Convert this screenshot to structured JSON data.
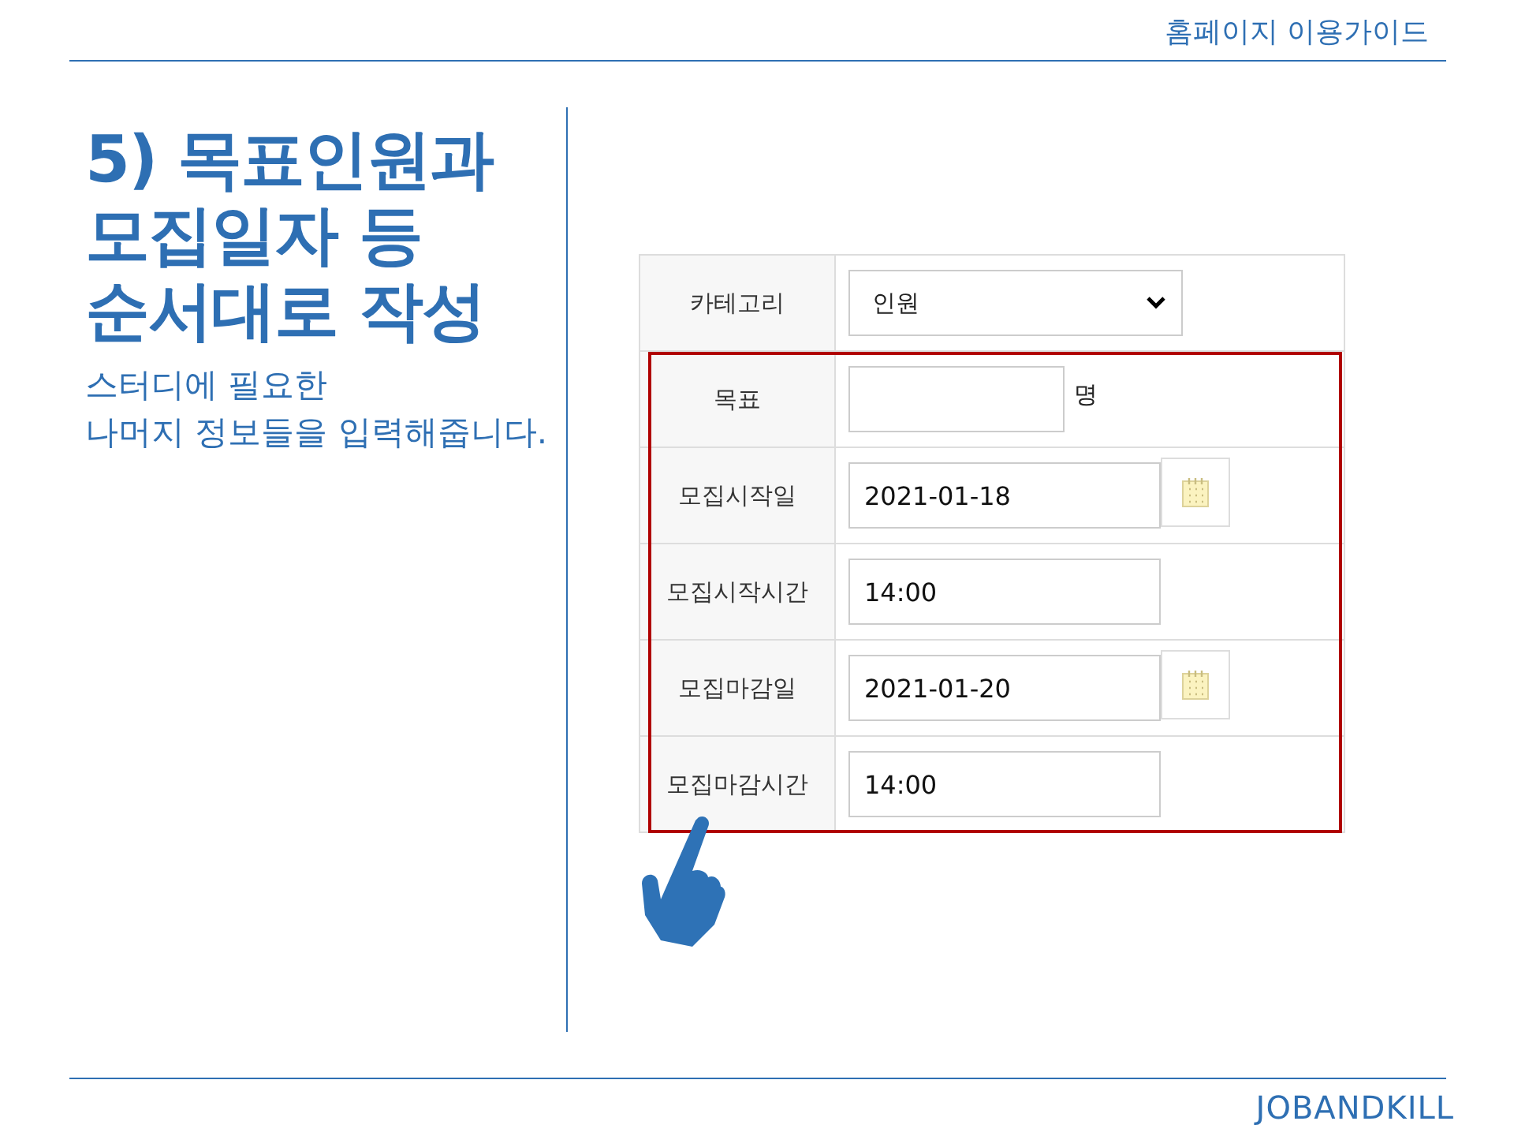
{
  "header": {
    "title": "홈페이지 이용가이드"
  },
  "heading": {
    "lines": [
      "5) 목표인원과",
      "모집일자 등",
      "순서대로 작성"
    ]
  },
  "description": {
    "lines": [
      "스터디에 필요한",
      "나머지 정보들을 입력해줍니다."
    ]
  },
  "form": {
    "rows": [
      {
        "label": "카테고리",
        "kind": "select",
        "value": "인원"
      }
    ],
    "highlighted_rows": [
      {
        "label": "목표",
        "kind": "number",
        "unit": "명"
      },
      {
        "label": "모집시작일",
        "kind": "date",
        "value": "2021-01-18"
      },
      {
        "label": "모집시작시간",
        "kind": "time",
        "value": "14:00"
      },
      {
        "label": "모집마감일",
        "kind": "date",
        "value": "2021-01-20"
      },
      {
        "label": "모집마감시간",
        "kind": "time",
        "value": "14:00"
      }
    ]
  },
  "footer": {
    "brand": "JOBANDKILL"
  }
}
